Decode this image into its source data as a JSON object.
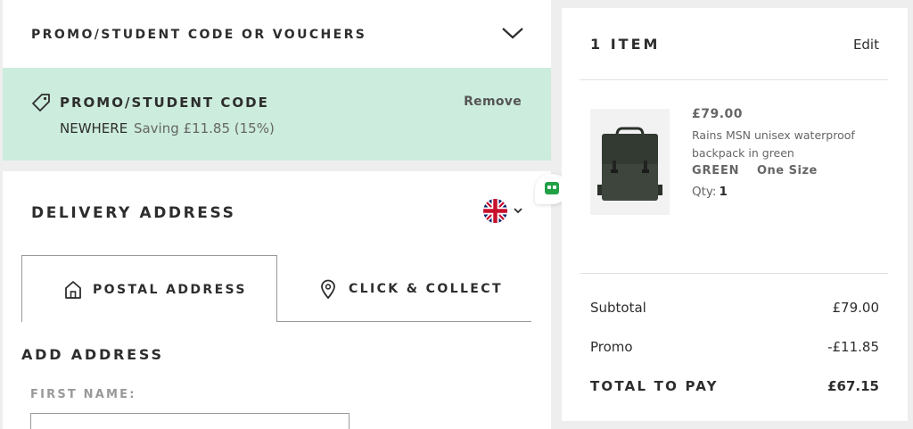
{
  "promo_section": {
    "header": "PROMO/STUDENT CODE OR VOUCHERS",
    "applied_title": "PROMO/STUDENT CODE",
    "remove_label": "Remove",
    "code": "NEWHERE",
    "saving": "Saving £11.85 (15%)",
    "background_color": "#ccecdd"
  },
  "delivery": {
    "title": "DELIVERY ADDRESS",
    "country_flag": "uk-flag",
    "tabs": [
      {
        "label": "POSTAL ADDRESS",
        "icon": "home-icon",
        "active": true
      },
      {
        "label": "CLICK & COLLECT",
        "icon": "location-pin-icon",
        "active": false
      }
    ],
    "add_address_title": "ADD ADDRESS",
    "first_name_label": "FIRST NAME:",
    "first_name_value": ""
  },
  "summary": {
    "items_title": "1 ITEM",
    "edit_label": "Edit",
    "product": {
      "price": "£79.00",
      "name": "Rains MSN unisex waterproof backpack in green",
      "color": "GREEN",
      "size": "One Size",
      "qty_label": "Qty:",
      "qty": "1"
    },
    "subtotal_label": "Subtotal",
    "subtotal_value": "£79.00",
    "promo_label": "Promo",
    "promo_value": "-£11.85",
    "total_label": "TOTAL TO PAY",
    "total_value": "£67.15"
  }
}
